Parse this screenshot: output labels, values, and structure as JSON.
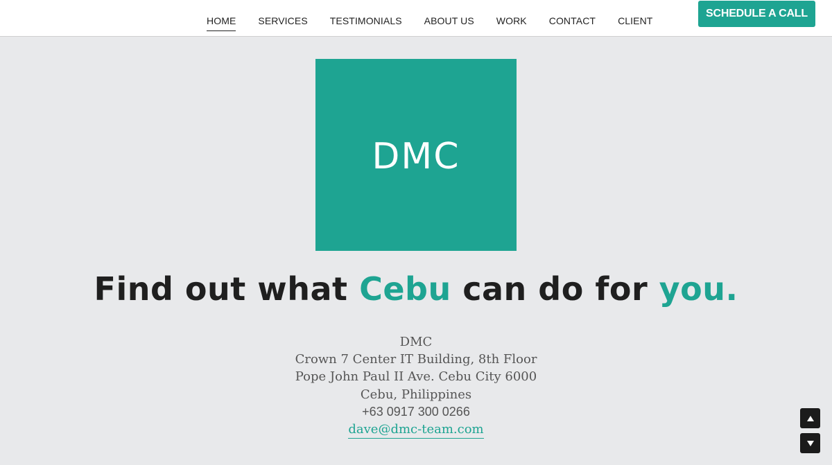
{
  "nav": {
    "items": [
      {
        "label": "HOME"
      },
      {
        "label": "SERVICES"
      },
      {
        "label": "TESTIMONIALS"
      },
      {
        "label": "ABOUT US"
      },
      {
        "label": "WORK"
      },
      {
        "label": "CONTACT"
      },
      {
        "label": "CLIENT"
      }
    ],
    "active": "HOME"
  },
  "cta": {
    "label": "SCHEDULE A CALL"
  },
  "logo": {
    "text": "DMC"
  },
  "headline": {
    "part1": "Find out what ",
    "accent1": "Cebu",
    "part2": " can do for ",
    "accent2": "you."
  },
  "address": {
    "name": "DMC",
    "line1": "Crown 7 Center IT Building, 8th Floor",
    "line2": "Pope John Paul II Ave. Cebu City 6000",
    "line3": "Cebu, Philippines",
    "phone": "+63 0917 300 0266",
    "email": "dave@dmc-team.com"
  },
  "scroll": {
    "up_icon": "triangle-up-icon",
    "down_icon": "triangle-down-icon"
  },
  "colors": {
    "accent": "#1ea492",
    "background": "#e8e9eb",
    "text": "#1f1f1f"
  }
}
